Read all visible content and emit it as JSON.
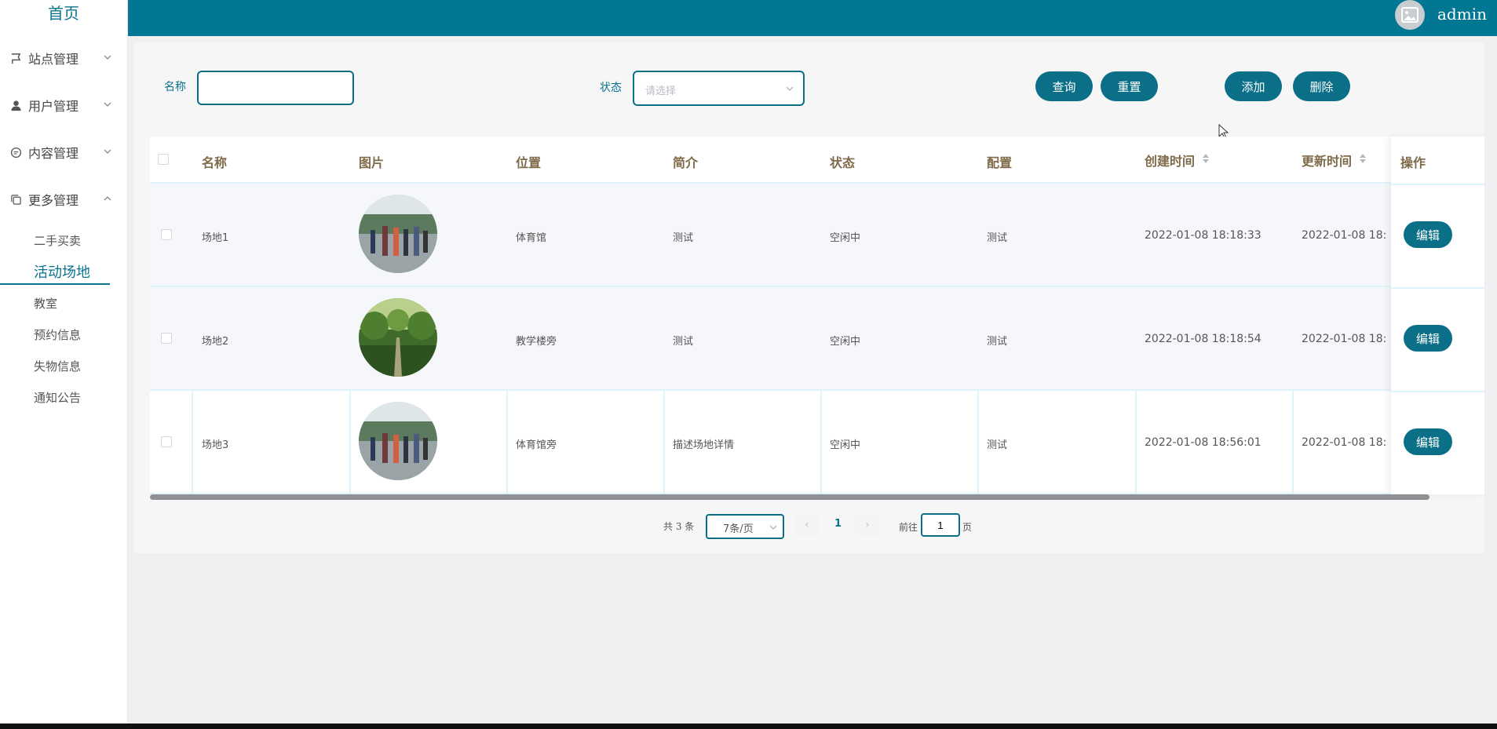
{
  "sidebar": {
    "home": "首页",
    "menus": [
      {
        "label": "站点管理",
        "icon": "flag-icon"
      },
      {
        "label": "用户管理",
        "icon": "user-icon"
      },
      {
        "label": "内容管理",
        "icon": "chat-icon"
      },
      {
        "label": "更多管理",
        "icon": "copy-icon"
      }
    ],
    "submenu": [
      "二手买卖",
      "活动场地",
      "教室",
      "预约信息",
      "失物信息",
      "通知公告"
    ],
    "active_submenu": "活动场地"
  },
  "header": {
    "username": "admin"
  },
  "search": {
    "name_label": "名称",
    "name_value": "",
    "status_label": "状态",
    "status_placeholder": "请选择",
    "query_btn": "查询",
    "reset_btn": "重置",
    "add_btn": "添加",
    "delete_btn": "删除"
  },
  "table": {
    "columns": [
      "名称",
      "图片",
      "位置",
      "简介",
      "状态",
      "配置",
      "创建时间",
      "更新时间",
      "操作"
    ],
    "rows": [
      {
        "name": "场地1",
        "location": "体育馆",
        "intro": "测试",
        "status": "空闲中",
        "config": "测试",
        "created": "2022-01-08 18:18:33",
        "updated": "2022-01-08 18:",
        "action": "编辑",
        "image": "crowd"
      },
      {
        "name": "场地2",
        "location": "教学楼旁",
        "intro": "测试",
        "status": "空闲中",
        "config": "测试",
        "created": "2022-01-08 18:18:54",
        "updated": "2022-01-08 18:",
        "action": "编辑",
        "image": "trees"
      },
      {
        "name": "场地3",
        "location": "体育馆旁",
        "intro": "描述场地详情",
        "status": "空闲中",
        "config": "测试",
        "created": "2022-01-08 18:56:01",
        "updated": "2022-01-08 18:",
        "action": "编辑",
        "image": "crowd"
      }
    ]
  },
  "pagination": {
    "total": "共 3 条",
    "page_size": "7条/页",
    "current_page": "1",
    "goto_label": "前往",
    "goto_value": "1",
    "page_suffix": "页"
  },
  "colors": {
    "primary": "#027793",
    "accent": "#0b6f88"
  }
}
